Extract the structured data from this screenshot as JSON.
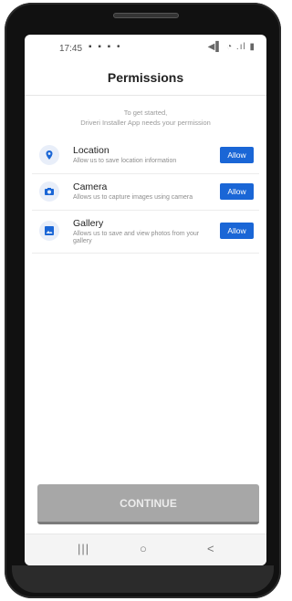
{
  "status_bar": {
    "time": "17:45",
    "left_icons": "▪ ▪ ▪ •",
    "right_icons": "◀▌ ◔ .ıl ▮"
  },
  "header": {
    "title": "Permissions"
  },
  "intro": {
    "line1": "To get started,",
    "line2": "Driveri Installer App needs your permission"
  },
  "permissions": [
    {
      "icon": "location-pin-icon",
      "title": "Location",
      "description": "Allow us to save location information",
      "button": "Allow"
    },
    {
      "icon": "camera-icon",
      "title": "Camera",
      "description": "Allows us to capture images using camera",
      "button": "Allow"
    },
    {
      "icon": "gallery-icon",
      "title": "Gallery",
      "description": "Allows us to save and view photos from your gallery",
      "button": "Allow"
    }
  ],
  "continue_button": "CONTINUE",
  "navigation_bar": {
    "recents": "|||",
    "home": "○",
    "back": "<"
  },
  "colors": {
    "accent": "#1a66d6",
    "disabled_button": "#a7a7a7"
  }
}
